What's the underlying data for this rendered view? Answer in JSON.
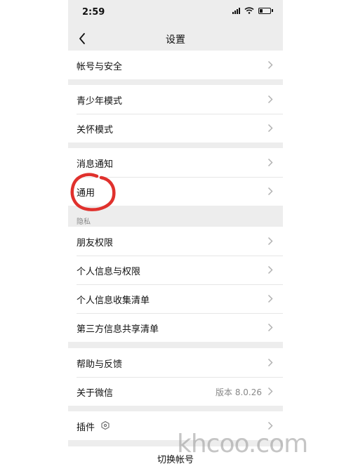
{
  "status_bar": {
    "time": "2:59"
  },
  "nav": {
    "title": "设置"
  },
  "groups": [
    {
      "items": [
        {
          "label": "帐号与安全"
        }
      ]
    },
    {
      "items": [
        {
          "label": "青少年模式"
        },
        {
          "label": "关怀模式"
        }
      ]
    },
    {
      "items": [
        {
          "label": "消息通知"
        },
        {
          "label": "通用"
        }
      ]
    },
    {
      "section_label": "隐私",
      "items": [
        {
          "label": "朋友权限"
        },
        {
          "label": "个人信息与权限"
        },
        {
          "label": "个人信息收集清单"
        },
        {
          "label": "第三方信息共享清单"
        }
      ]
    },
    {
      "items": [
        {
          "label": "帮助与反馈"
        },
        {
          "label": "关于微信",
          "value": "版本 8.0.26"
        }
      ]
    },
    {
      "items": [
        {
          "label": "插件",
          "icon": "plugin-icon"
        }
      ]
    }
  ],
  "footer": {
    "switch_account": "切换帐号"
  },
  "annotation": {
    "circle_color": "#e0312d"
  },
  "watermark": "khcoo.com",
  "colors": {
    "background": "#ededed",
    "row": "#ffffff",
    "text": "#111111",
    "secondary": "#888888"
  }
}
